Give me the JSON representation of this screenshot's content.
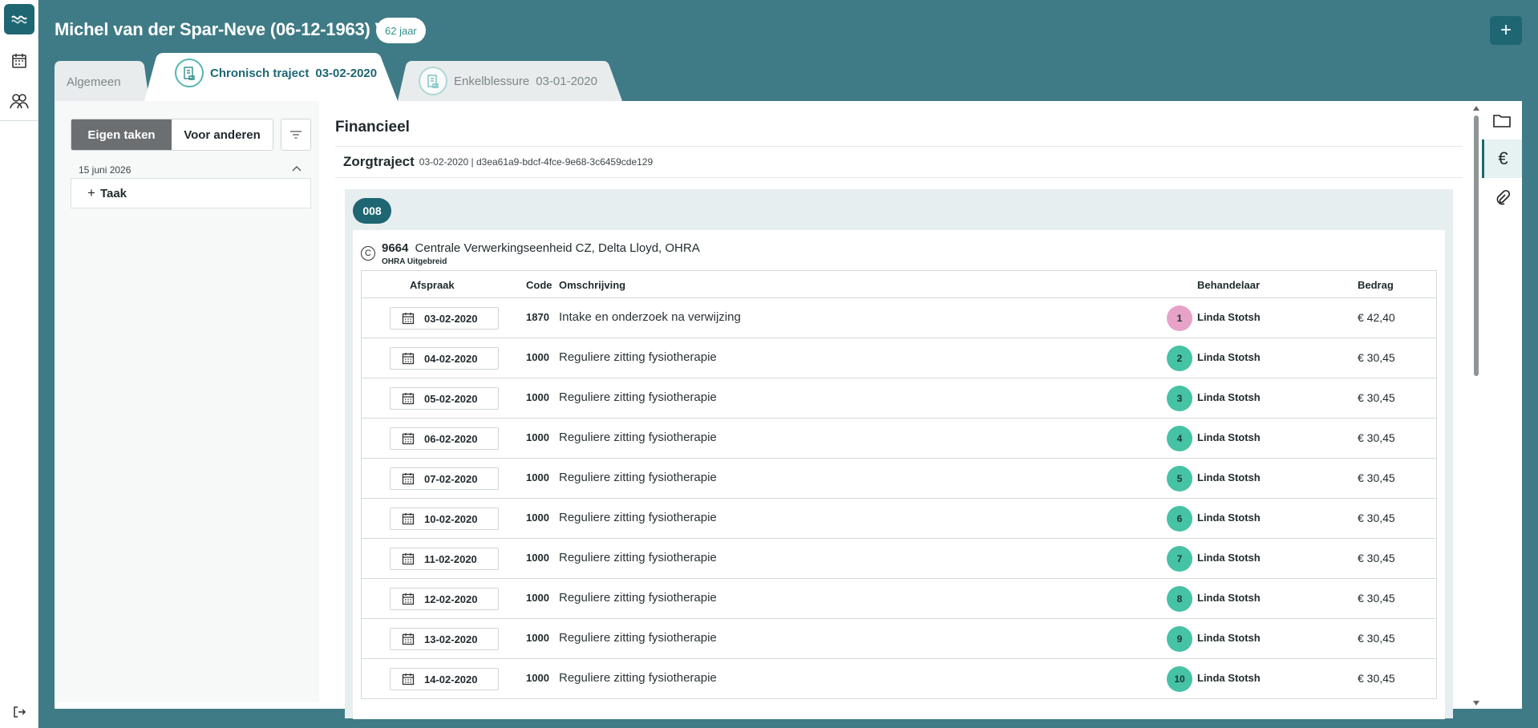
{
  "header": {
    "patient": "Michel van der Spar-Neve (06-12-1963) V",
    "age": "62 jaar"
  },
  "tabs": [
    {
      "label": "Algemeen",
      "date": ""
    },
    {
      "label": "Chronisch traject",
      "date": "03-02-2020"
    },
    {
      "label": "Enkelblessure",
      "date": "03-01-2020"
    }
  ],
  "tasks": {
    "own": "Eigen taken",
    "others": "Voor anderen",
    "date": "15 juni 2026",
    "add": "Taak"
  },
  "finance": {
    "title": "Financieel",
    "zorg_title": "Zorgtraject",
    "zorg_meta": "03-02-2020 | d3ea61a9-bdcf-4fce-9e68-3c6459cde129",
    "group": "008",
    "insurer_code": "9664",
    "insurer_name": "Centrale Verwerkingseenheid CZ, Delta Lloyd, OHRA",
    "insurer_plan": "OHRA Uitgebreid",
    "columns": {
      "afspraak": "Afspraak",
      "code": "Code",
      "omschrijving": "Omschrijving",
      "behandelaar": "Behandelaar",
      "bedrag": "Bedrag"
    },
    "rows": [
      {
        "date": "03-02-2020",
        "code": "1870",
        "desc": "Intake en onderzoek na verwijzing",
        "num": "1",
        "beh": "Linda Stotsh",
        "amount": "€ 42,40"
      },
      {
        "date": "04-02-2020",
        "code": "1000",
        "desc": "Reguliere zitting fysiotherapie",
        "num": "2",
        "beh": "Linda Stotsh",
        "amount": "€ 30,45"
      },
      {
        "date": "05-02-2020",
        "code": "1000",
        "desc": "Reguliere zitting fysiotherapie",
        "num": "3",
        "beh": "Linda Stotsh",
        "amount": "€ 30,45"
      },
      {
        "date": "06-02-2020",
        "code": "1000",
        "desc": "Reguliere zitting fysiotherapie",
        "num": "4",
        "beh": "Linda Stotsh",
        "amount": "€ 30,45"
      },
      {
        "date": "07-02-2020",
        "code": "1000",
        "desc": "Reguliere zitting fysiotherapie",
        "num": "5",
        "beh": "Linda Stotsh",
        "amount": "€ 30,45"
      },
      {
        "date": "10-02-2020",
        "code": "1000",
        "desc": "Reguliere zitting fysiotherapie",
        "num": "6",
        "beh": "Linda Stotsh",
        "amount": "€ 30,45"
      },
      {
        "date": "11-02-2020",
        "code": "1000",
        "desc": "Reguliere zitting fysiotherapie",
        "num": "7",
        "beh": "Linda Stotsh",
        "amount": "€ 30,45"
      },
      {
        "date": "12-02-2020",
        "code": "1000",
        "desc": "Reguliere zitting fysiotherapie",
        "num": "8",
        "beh": "Linda Stotsh",
        "amount": "€ 30,45"
      },
      {
        "date": "13-02-2020",
        "code": "1000",
        "desc": "Reguliere zitting fysiotherapie",
        "num": "9",
        "beh": "Linda Stotsh",
        "amount": "€ 30,45"
      },
      {
        "date": "14-02-2020",
        "code": "1000",
        "desc": "Reguliere zitting fysiotherapie",
        "num": "10",
        "beh": "Linda Stotsh",
        "amount": "€ 30,45"
      }
    ]
  },
  "icons": {
    "rail": [
      "app-logo-icon",
      "calendar-icon",
      "patients-icon",
      "logout-icon"
    ],
    "side": [
      "folder-icon",
      "euro-icon",
      "paperclip-icon"
    ]
  },
  "colors": {
    "background": "#3f7b86",
    "accent": "#1f6673",
    "teal": "#46c2a4",
    "pink": "#e7a2c7"
  }
}
